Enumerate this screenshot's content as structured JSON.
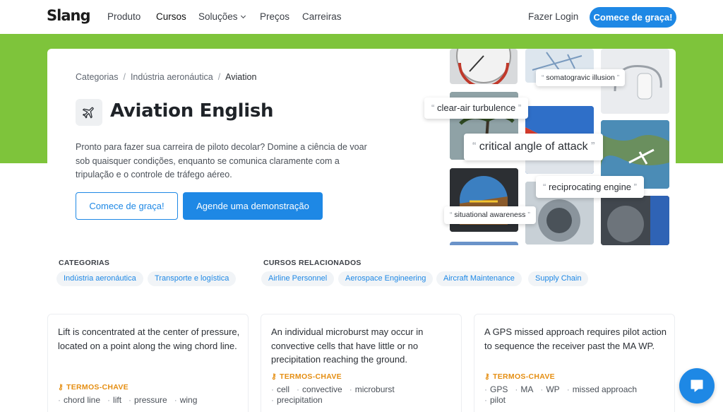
{
  "nav": {
    "logo": "Slang",
    "links": [
      "Produto",
      "Cursos",
      "Soluções",
      "Preços",
      "Carreiras"
    ],
    "login": "Fazer Login",
    "cta": "Comece de graça!"
  },
  "hero": {
    "breadcrumb": [
      "Categorias",
      "Indústria aeronáutica",
      "Aviation"
    ],
    "title": "Aviation English",
    "description": "Pronto para fazer sua carreira de piloto decolar? Domine a ciência de voar sob quaisquer condições, enquanto se comunica claramente com a tripulação e o controle de tráfego aéreo.",
    "primary_button": "Comece de graça!",
    "secondary_button": "Agende uma demonstração",
    "phrases": [
      "somatogravic illusion",
      "clear-air turbulence",
      "critical angle of attack",
      "reciprocating engine",
      "situational awareness"
    ]
  },
  "categories": {
    "label": "CATEGORIAS",
    "tags": [
      "Indústria aeronáutica",
      "Transporte e logística"
    ]
  },
  "related": {
    "label": "CURSOS RELACIONADOS",
    "tags": [
      "Airline Personnel",
      "Aerospace Engineering",
      "Aircraft Maintenance",
      "Supply Chain"
    ]
  },
  "cards": [
    {
      "text": "Lift  is concentrated at the center of pressure, located on a point along the wing  chord line.",
      "keywords_label": "TERMOS-CHAVE",
      "keywords": [
        "chord line",
        "lift",
        "pressure",
        "wing"
      ]
    },
    {
      "text": "An individual microburst  may occur in convective  cells that have little or no precipitation  reaching the ground.",
      "keywords_label": "TERMOS-CHAVE",
      "keywords": [
        "cell",
        "convective",
        "microburst",
        "precipitation"
      ]
    },
    {
      "text": "A GPS  missed approach  requires pilot action to sequence the receiver past the MA WP.",
      "keywords_label": "TERMOS-CHAVE",
      "keywords": [
        "GPS",
        "MA",
        "WP",
        "missed approach",
        "pilot"
      ]
    }
  ],
  "colors": {
    "accent": "#1e88e5",
    "band": "#7ec43b",
    "keyword": "#e58e12"
  }
}
